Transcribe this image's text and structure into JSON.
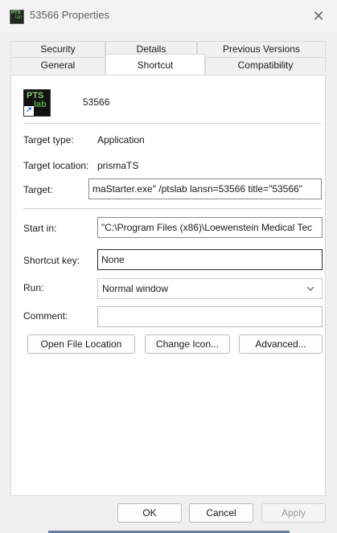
{
  "window": {
    "title": "53566 Properties",
    "close_glyph": "✕"
  },
  "tabs": {
    "row1": [
      "Security",
      "Details",
      "Previous Versions"
    ],
    "row2": [
      "General",
      "Shortcut",
      "Compatibility"
    ],
    "active": "Shortcut"
  },
  "shortcut": {
    "icon": "ptslab-shortcut-icon",
    "icon_text_top": "PTS",
    "icon_text_bottom": "lab",
    "name": "53566",
    "target_type_label": "Target type:",
    "target_type_value": "Application",
    "target_location_label": "Target location:",
    "target_location_value": "prismaTS",
    "target_label": "Target:",
    "target_value": "maStarter.exe\" /ptslab lansn=53566 title=\"53566\"",
    "start_in_label": "Start in:",
    "start_in_value": "\"C:\\Program Files (x86)\\Loewenstein Medical Tec",
    "shortcut_key_label": "Shortcut key:",
    "shortcut_key_value": "None",
    "run_label": "Run:",
    "run_value": "Normal window",
    "comment_label": "Comment:",
    "comment_value": ""
  },
  "buttons": {
    "open_file_location": "Open File Location",
    "change_icon": "Change Icon...",
    "advanced": "Advanced..."
  },
  "footer": {
    "ok": "OK",
    "cancel": "Cancel",
    "apply": "Apply"
  },
  "colors": {
    "accent": "#1b6dd1",
    "window_bg": "#f0f0f0",
    "panel_bg": "#ffffff"
  }
}
